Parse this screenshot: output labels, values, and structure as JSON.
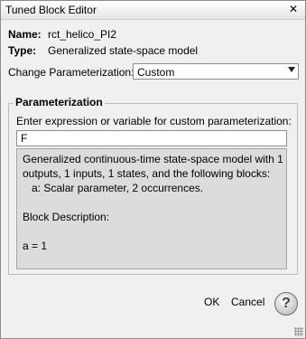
{
  "window": {
    "title": "Tuned Block Editor",
    "close_symbol": "✕"
  },
  "info": {
    "name_label": "Name:",
    "name_value": "rct_helico_PI2",
    "type_label": "Type:",
    "type_value": "Generalized state-space model"
  },
  "parameterization_select": {
    "label": "Change Parameterization:",
    "value": "Custom"
  },
  "group": {
    "title": "Parameterization",
    "expr_label": "Enter expression or variable for custom parameterization:",
    "expr_value": "F",
    "description_lines": [
      "Generalized continuous-time state-space model with 1",
      "outputs, 1 inputs, 1 states, and the following blocks:",
      "   a: Scalar parameter, 2 occurrences.",
      "",
      "Block Description:",
      "",
      "a = 1"
    ]
  },
  "buttons": {
    "ok": "OK",
    "cancel": "Cancel",
    "help": "?"
  },
  "icons": {
    "help": "help-icon",
    "close": "close-icon",
    "dropdown": "chevron-down-icon"
  }
}
